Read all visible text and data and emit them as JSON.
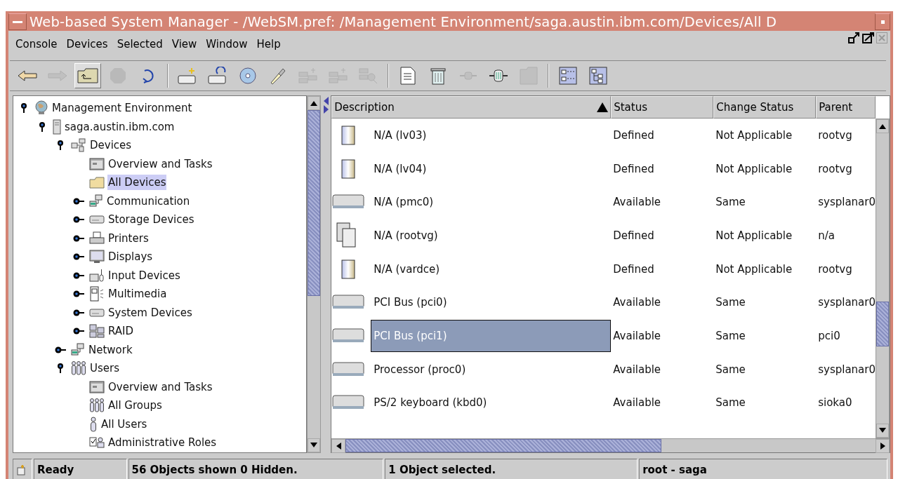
{
  "window": {
    "title": "Web-based System Manager - /WebSM.pref: /Management Environment/saga.austin.ibm.com/Devices/All D"
  },
  "menu": [
    "Console",
    "Devices",
    "Selected",
    "View",
    "Window",
    "Help"
  ],
  "toolbar": [
    {
      "kind": "back",
      "disabled": false,
      "pressed": false
    },
    {
      "kind": "forward",
      "disabled": true,
      "pressed": false
    },
    {
      "kind": "up",
      "disabled": false,
      "pressed": true
    },
    {
      "kind": "stop",
      "disabled": true,
      "pressed": false
    },
    {
      "kind": "reload",
      "disabled": false,
      "pressed": false
    },
    {
      "kind": "sep"
    },
    {
      "kind": "add-host",
      "disabled": false,
      "pressed": false
    },
    {
      "kind": "reconnect",
      "disabled": false,
      "pressed": false
    },
    {
      "kind": "disc",
      "disabled": false,
      "pressed": false
    },
    {
      "kind": "flashlight",
      "disabled": false,
      "pressed": false
    },
    {
      "kind": "group",
      "disabled": true,
      "pressed": false
    },
    {
      "kind": "group",
      "disabled": true,
      "pressed": false
    },
    {
      "kind": "find",
      "disabled": true,
      "pressed": false
    },
    {
      "kind": "sep"
    },
    {
      "kind": "properties",
      "disabled": false,
      "pressed": false
    },
    {
      "kind": "delete",
      "disabled": false,
      "pressed": false
    },
    {
      "kind": "plug",
      "disabled": true,
      "pressed": false
    },
    {
      "kind": "connector",
      "disabled": false,
      "pressed": false
    },
    {
      "kind": "folder-x",
      "disabled": true,
      "pressed": false
    },
    {
      "kind": "sep"
    },
    {
      "kind": "details-view",
      "disabled": false,
      "pressed": false
    },
    {
      "kind": "tree-view",
      "disabled": false,
      "pressed": false
    }
  ],
  "tree": [
    {
      "label": "Management Environment",
      "kind": "globe",
      "expanded": true,
      "selected": false,
      "children": [
        {
          "label": "saga.austin.ibm.com",
          "kind": "server",
          "expanded": true,
          "selected": false,
          "children": [
            {
              "label": "Devices",
              "kind": "devices",
              "expanded": true,
              "selected": false,
              "children": [
                {
                  "label": "Overview and Tasks",
                  "kind": "overview",
                  "selected": false
                },
                {
                  "label": "All Devices",
                  "kind": "folder",
                  "selected": true
                },
                {
                  "label": "Communication",
                  "kind": "network",
                  "expanded": false,
                  "selected": false
                },
                {
                  "label": "Storage Devices",
                  "kind": "drive",
                  "expanded": false,
                  "selected": false
                },
                {
                  "label": "Printers",
                  "kind": "printer",
                  "expanded": false,
                  "selected": false
                },
                {
                  "label": "Displays",
                  "kind": "monitor",
                  "expanded": false,
                  "selected": false
                },
                {
                  "label": "Input Devices",
                  "kind": "input",
                  "expanded": false,
                  "selected": false
                },
                {
                  "label": "Multimedia",
                  "kind": "speaker",
                  "expanded": false,
                  "selected": false
                },
                {
                  "label": "System Devices",
                  "kind": "drive",
                  "expanded": false,
                  "selected": false
                },
                {
                  "label": "RAID",
                  "kind": "raid",
                  "expanded": false,
                  "selected": false
                }
              ]
            },
            {
              "label": "Network",
              "kind": "network",
              "expanded": false,
              "selected": false
            },
            {
              "label": "Users",
              "kind": "users",
              "expanded": true,
              "selected": false,
              "children": [
                {
                  "label": "Overview and Tasks",
                  "kind": "overview",
                  "selected": false
                },
                {
                  "label": "All Groups",
                  "kind": "users",
                  "selected": false
                },
                {
                  "label": "All Users",
                  "kind": "user",
                  "selected": false
                },
                {
                  "label": "Administrative Roles",
                  "kind": "roles",
                  "selected": false
                }
              ]
            }
          ]
        }
      ]
    }
  ],
  "table": {
    "columns": [
      {
        "label": "Description",
        "sorted": true
      },
      {
        "label": "Status",
        "sorted": false
      },
      {
        "label": "Change Status",
        "sorted": false
      },
      {
        "label": "Parent",
        "sorted": false
      }
    ],
    "rows": [
      {
        "kind": "volume",
        "description": "N/A (lv03)",
        "status": "Defined",
        "change_status": "Not Applicable",
        "parent": "rootvg",
        "selected": false
      },
      {
        "kind": "volume",
        "description": "N/A (lv04)",
        "status": "Defined",
        "change_status": "Not Applicable",
        "parent": "rootvg",
        "selected": false
      },
      {
        "kind": "card",
        "description": "N/A (pmc0)",
        "status": "Available",
        "change_status": "Same",
        "parent": "sysplanar0",
        "selected": false
      },
      {
        "kind": "volumes",
        "description": "N/A (rootvg)",
        "status": "Defined",
        "change_status": "Not Applicable",
        "parent": "n/a",
        "selected": false
      },
      {
        "kind": "volume",
        "description": "N/A (vardce)",
        "status": "Defined",
        "change_status": "Not Applicable",
        "parent": "rootvg",
        "selected": false
      },
      {
        "kind": "card",
        "description": "PCI Bus (pci0)",
        "status": "Available",
        "change_status": "Same",
        "parent": "sysplanar0",
        "selected": false
      },
      {
        "kind": "card",
        "description": "PCI Bus (pci1)",
        "status": "Available",
        "change_status": "Same",
        "parent": "pci0",
        "selected": true
      },
      {
        "kind": "card",
        "description": "Processor (proc0)",
        "status": "Available",
        "change_status": "Same",
        "parent": "sysplanar0",
        "selected": false
      },
      {
        "kind": "card",
        "description": "PS/2 keyboard (kbd0)",
        "status": "Available",
        "change_status": "Same",
        "parent": "sioka0",
        "selected": false
      }
    ]
  },
  "status_bar": [
    "Ready",
    "56 Objects shown 0 Hidden.",
    "1 Object selected.",
    "root - saga"
  ]
}
